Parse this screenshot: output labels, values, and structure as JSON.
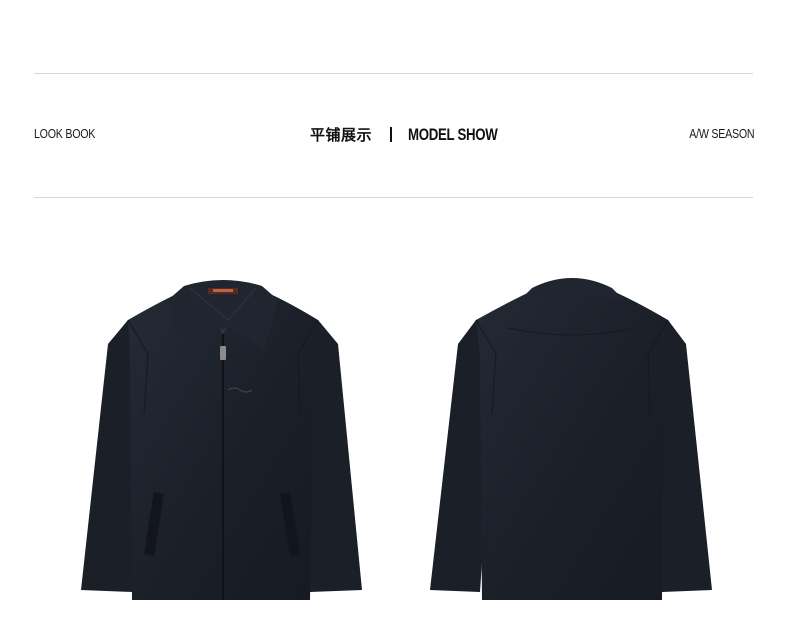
{
  "header": {
    "left_label": "LOOK BOOK",
    "title_cn": "平铺展示",
    "title_en": "MODEL SHOW",
    "right_label": "A/W SEASON"
  },
  "products": [
    {
      "view": "front",
      "icon": "jacket-front-image"
    },
    {
      "view": "back",
      "icon": "jacket-back-image"
    }
  ],
  "colors": {
    "jacket": "#1d222c",
    "rule": "#d6d6d6",
    "text": "#111111"
  }
}
